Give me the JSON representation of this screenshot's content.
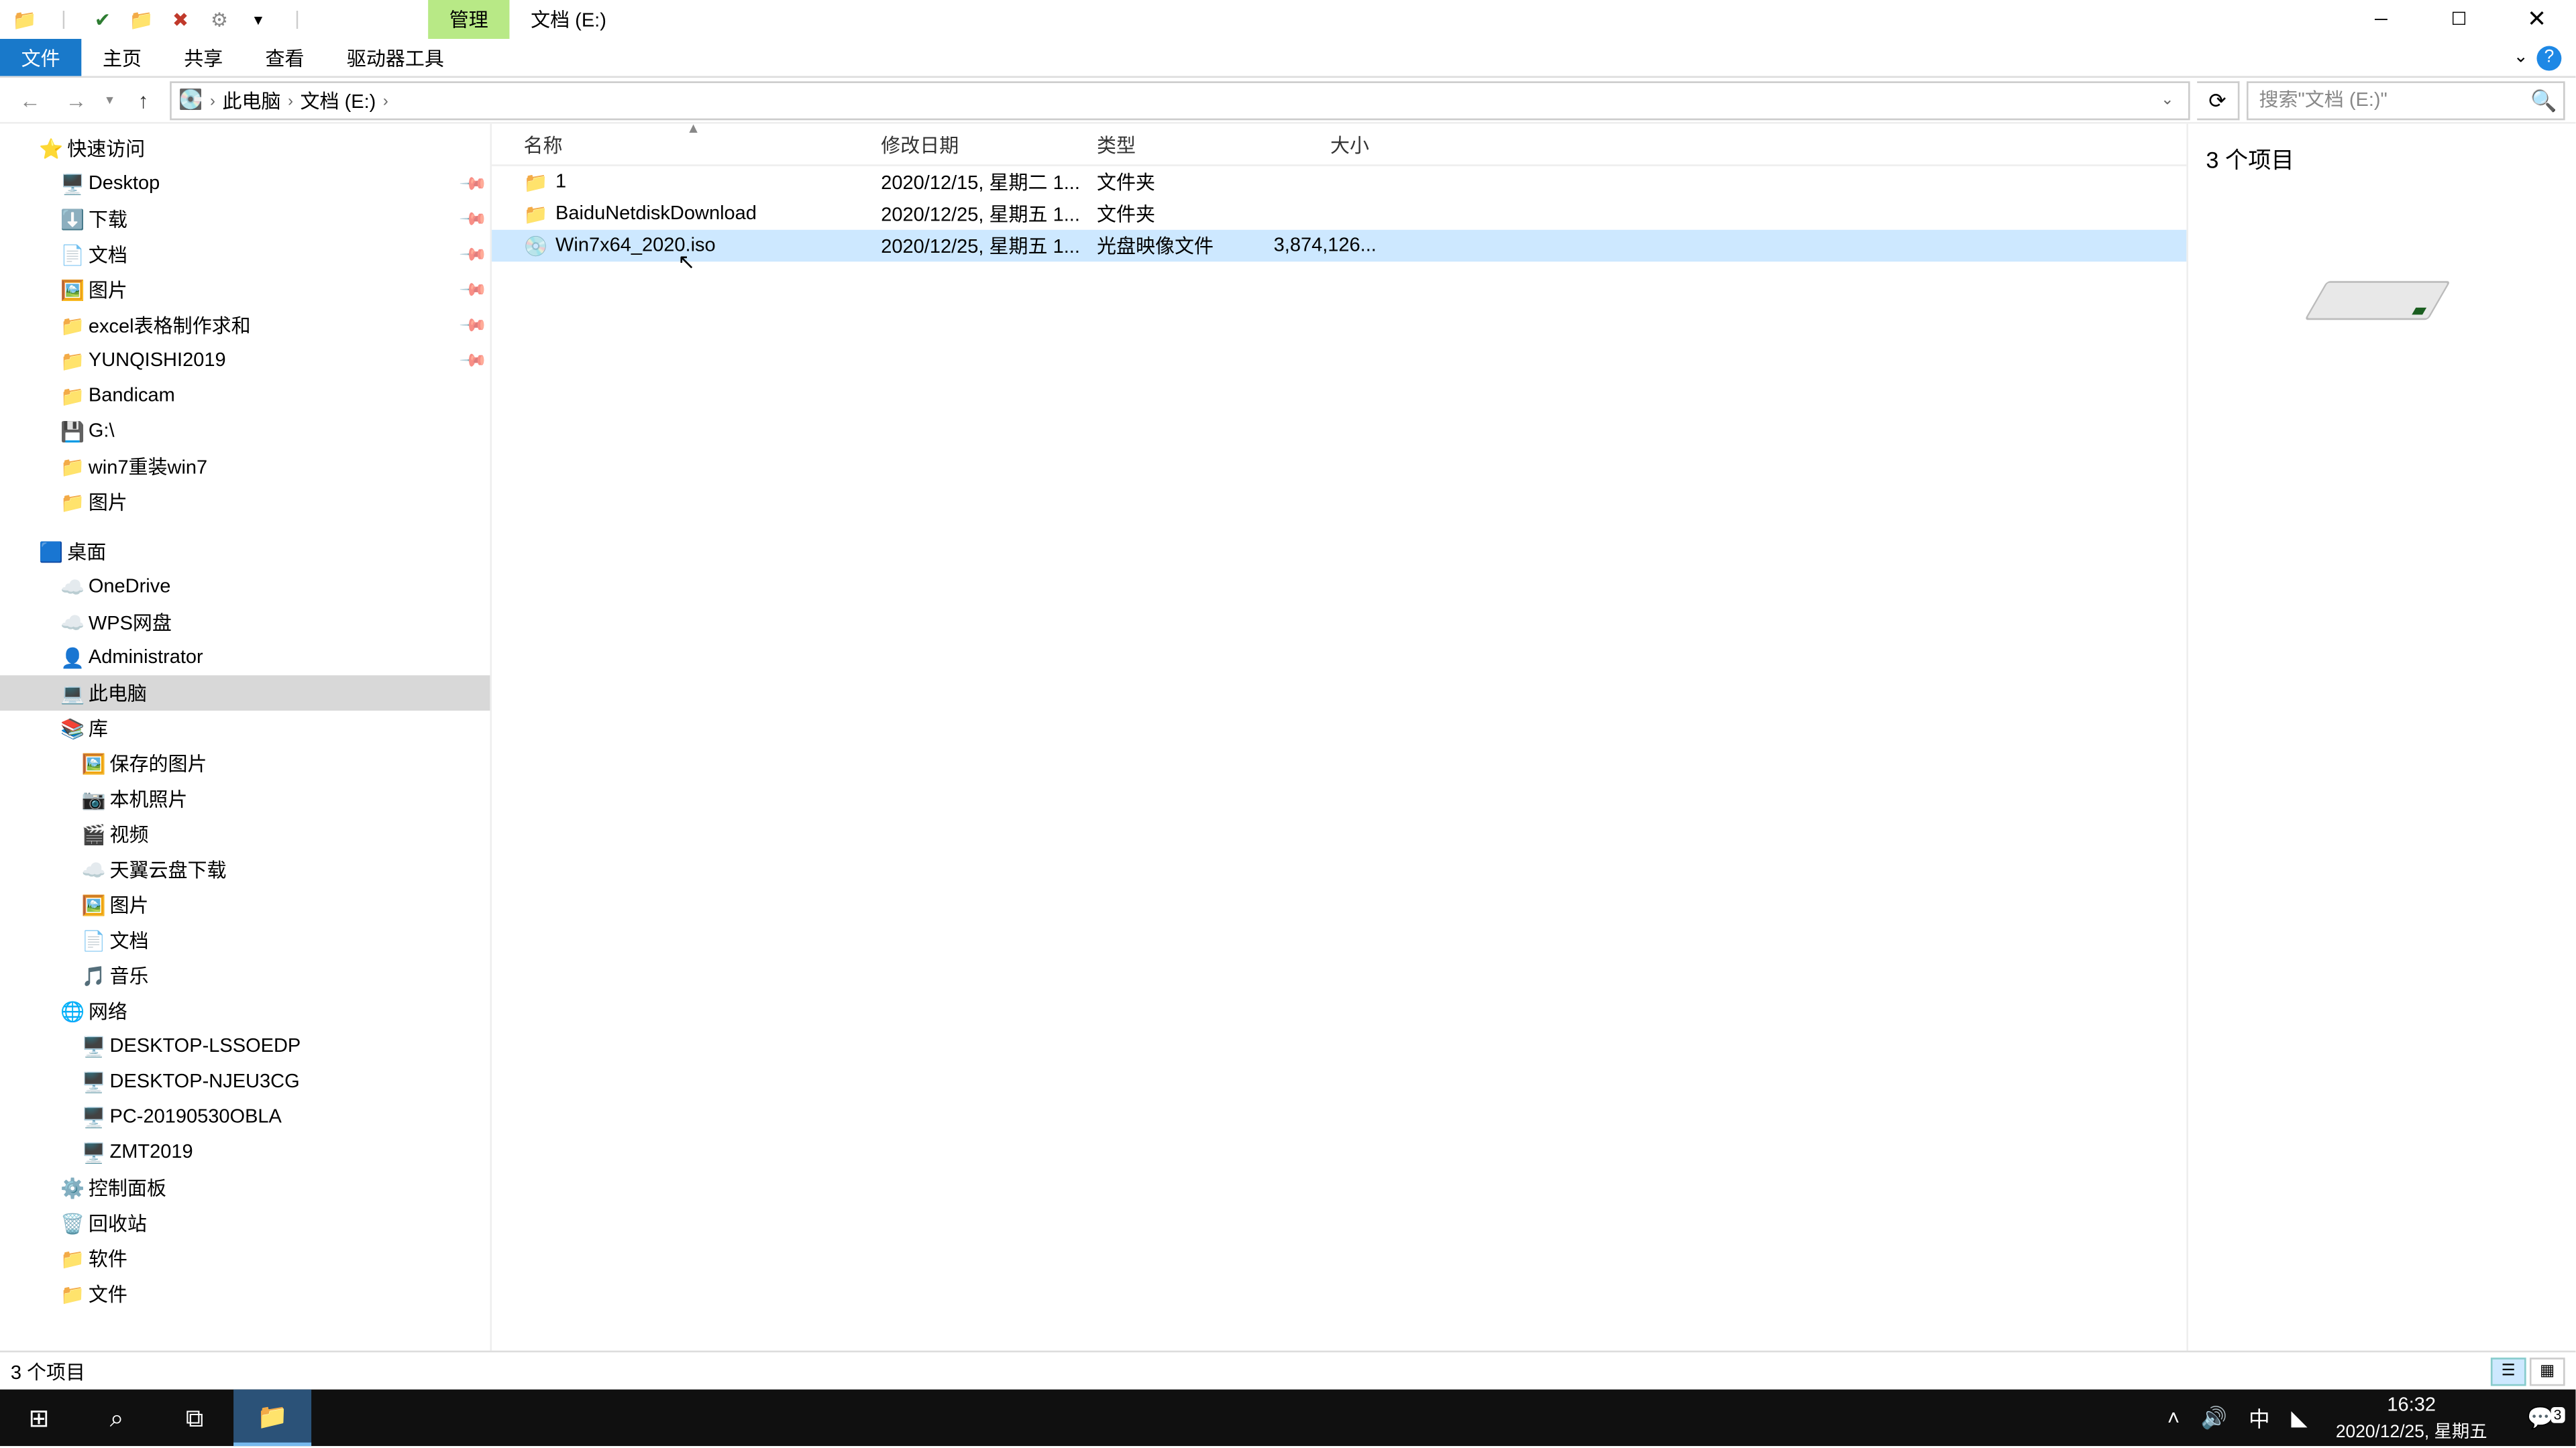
{
  "titlebar": {
    "manage_tab": "管理",
    "window_title": "文档 (E:)"
  },
  "ribbon": {
    "file": "文件",
    "home": "主页",
    "share": "共享",
    "view": "查看",
    "drive_tools": "驱动器工具"
  },
  "breadcrumb": {
    "this_pc": "此电脑",
    "drive": "文档 (E:)"
  },
  "search": {
    "placeholder": "搜索\"文档 (E:)\""
  },
  "columns": {
    "name": "名称",
    "date": "修改日期",
    "type": "类型",
    "size": "大小"
  },
  "rows": [
    {
      "icon": "📁",
      "name": "1",
      "date": "2020/12/15, 星期二 1...",
      "type": "文件夹",
      "size": "",
      "selected": false
    },
    {
      "icon": "📁",
      "name": "BaiduNetdiskDownload",
      "date": "2020/12/25, 星期五 1...",
      "type": "文件夹",
      "size": "",
      "selected": false
    },
    {
      "icon": "💿",
      "name": "Win7x64_2020.iso",
      "date": "2020/12/25, 星期五 1...",
      "type": "光盘映像文件",
      "size": "3,874,126...",
      "selected": true
    }
  ],
  "nav": {
    "quick_access": "快速访问",
    "qa_items": [
      {
        "icon": "🖥️",
        "label": "Desktop",
        "pin": true,
        "indent": 2
      },
      {
        "icon": "⬇️",
        "label": "下载",
        "pin": true,
        "indent": 2
      },
      {
        "icon": "📄",
        "label": "文档",
        "pin": true,
        "indent": 2
      },
      {
        "icon": "🖼️",
        "label": "图片",
        "pin": true,
        "indent": 2
      },
      {
        "icon": "📁",
        "label": "excel表格制作求和",
        "pin": true,
        "indent": 2
      },
      {
        "icon": "📁",
        "label": "YUNQISHI2019",
        "pin": true,
        "indent": 2
      },
      {
        "icon": "📁",
        "label": "Bandicam",
        "pin": false,
        "indent": 2
      },
      {
        "icon": "💾",
        "label": "G:\\",
        "pin": false,
        "indent": 2
      },
      {
        "icon": "📁",
        "label": "win7重装win7",
        "pin": false,
        "indent": 2
      },
      {
        "icon": "📁",
        "label": "图片",
        "pin": false,
        "indent": 2
      }
    ],
    "desktop": "桌面",
    "desktop_items": [
      {
        "icon": "☁️",
        "label": "OneDrive",
        "indent": 2
      },
      {
        "icon": "☁️",
        "label": "WPS网盘",
        "indent": 2
      },
      {
        "icon": "👤",
        "label": "Administrator",
        "indent": 2
      },
      {
        "icon": "💻",
        "label": "此电脑",
        "indent": 2,
        "selected": true
      },
      {
        "icon": "📚",
        "label": "库",
        "indent": 2
      },
      {
        "icon": "🖼️",
        "label": "保存的图片",
        "indent": 3
      },
      {
        "icon": "📷",
        "label": "本机照片",
        "indent": 3
      },
      {
        "icon": "🎬",
        "label": "视频",
        "indent": 3
      },
      {
        "icon": "☁️",
        "label": "天翼云盘下载",
        "indent": 3
      },
      {
        "icon": "🖼️",
        "label": "图片",
        "indent": 3
      },
      {
        "icon": "📄",
        "label": "文档",
        "indent": 3
      },
      {
        "icon": "🎵",
        "label": "音乐",
        "indent": 3
      },
      {
        "icon": "🌐",
        "label": "网络",
        "indent": 2
      },
      {
        "icon": "🖥️",
        "label": "DESKTOP-LSSOEDP",
        "indent": 3
      },
      {
        "icon": "🖥️",
        "label": "DESKTOP-NJEU3CG",
        "indent": 3
      },
      {
        "icon": "🖥️",
        "label": "PC-20190530OBLA",
        "indent": 3
      },
      {
        "icon": "🖥️",
        "label": "ZMT2019",
        "indent": 3
      },
      {
        "icon": "⚙️",
        "label": "控制面板",
        "indent": 2
      },
      {
        "icon": "🗑️",
        "label": "回收站",
        "indent": 2
      },
      {
        "icon": "📁",
        "label": "软件",
        "indent": 2
      },
      {
        "icon": "📁",
        "label": "文件",
        "indent": 2
      }
    ]
  },
  "preview": {
    "count": "3 个项目"
  },
  "status": {
    "items": "3 个项目"
  },
  "taskbar": {
    "time": "16:32",
    "date": "2020/12/25, 星期五",
    "ime": "中",
    "notif_count": "3"
  }
}
